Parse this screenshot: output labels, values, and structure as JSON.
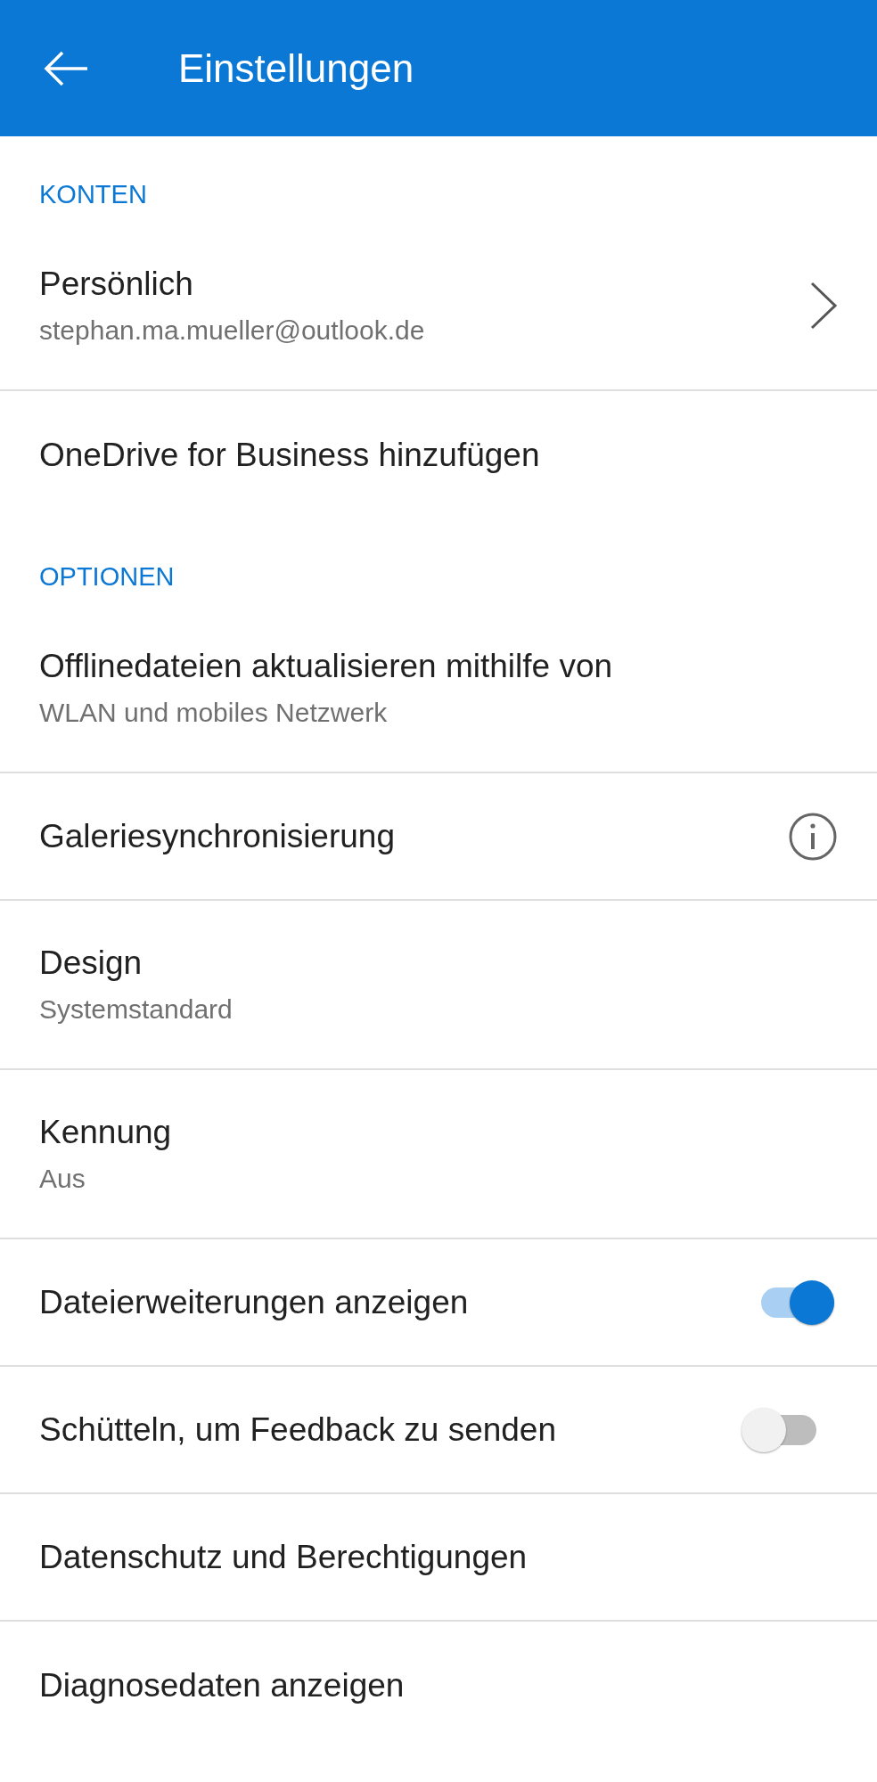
{
  "header": {
    "title": "Einstellungen"
  },
  "sections": [
    {
      "title": "KONTEN",
      "items": [
        {
          "kind": "nav",
          "label": "Persönlich",
          "subtitle": "stephan.ma.mueller@outlook.de"
        },
        {
          "kind": "plain",
          "label": "OneDrive for Business hinzufügen"
        }
      ]
    },
    {
      "title": "OPTIONEN",
      "items": [
        {
          "kind": "plain",
          "label": "Offlinedateien aktualisieren mithilfe von",
          "subtitle": "WLAN und mobiles Netzwerk"
        },
        {
          "kind": "info",
          "label": "Galeriesynchronisierung"
        },
        {
          "kind": "plain",
          "label": "Design",
          "subtitle": "Systemstandard"
        },
        {
          "kind": "plain",
          "label": "Kennung",
          "subtitle": "Aus"
        },
        {
          "kind": "toggle",
          "label": "Dateierweiterungen anzeigen",
          "on": true
        },
        {
          "kind": "toggle",
          "label": "Schütteln, um Feedback zu senden",
          "on": false
        },
        {
          "kind": "plain",
          "label": "Datenschutz und Berechtigungen"
        },
        {
          "kind": "plain",
          "label": "Diagnosedaten anzeigen"
        }
      ]
    }
  ]
}
